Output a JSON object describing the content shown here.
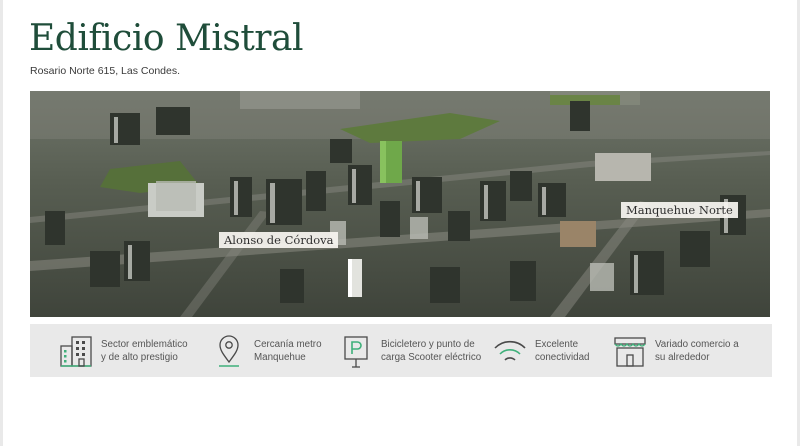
{
  "building": {
    "name": "Edificio Mistral",
    "address": "Rosario Norte 615, Las Condes."
  },
  "aerial_view": {
    "labels": {
      "street_1": "Alonso de Córdova",
      "street_2": "Manquehue Norte"
    }
  },
  "features": [
    {
      "icon": "office-building-icon",
      "label": "Sector emblemático\ny de alto prestigio"
    },
    {
      "icon": "location-pin-icon",
      "label": "Cercanía metro\nManquehue"
    },
    {
      "icon": "parking-sign-icon",
      "label": "Bicicletero y punto de\ncarga Scooter eléctrico"
    },
    {
      "icon": "wifi-signal-icon",
      "label": "Excelente\nconectividad"
    },
    {
      "icon": "storefront-icon",
      "label": "Variado comercio a\nsu alrededor"
    }
  ],
  "colors": {
    "title": "#1f4d3a",
    "accent": "#3fb07a",
    "icon_stroke": "#4a4a4a",
    "feature_bar": "#e9e9e9"
  }
}
